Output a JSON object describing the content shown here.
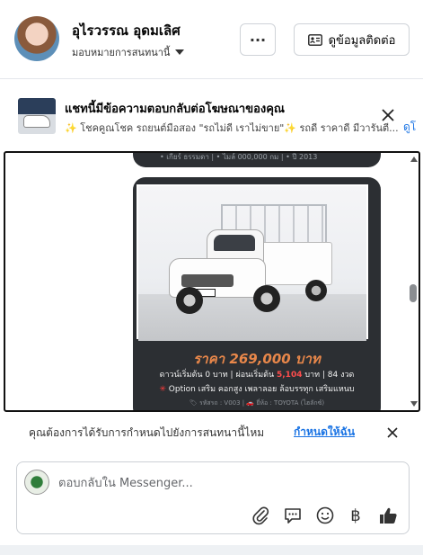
{
  "header": {
    "name": "อุไรวรรณ อุดมเลิศ",
    "role": "มอบหมายการสนทนานี้",
    "more_label": "···",
    "contact_label": "ดูข้อมูลติดต่อ"
  },
  "banner": {
    "title": "แชทนี้มีข้อความตอบกลับต่อโฆษณาของคุณ",
    "subtitle": "✨ โชคคูณโชค รถยนต์มือสอง \"รถไม่ดี เราไม่ขาย\"✨ รถดี ราคาดี มีวารันตี...",
    "link": "ดูโ"
  },
  "message": {
    "top_caption": "• เกียร์ ธรรมดา  |  • ไมล์ 000,000 กม  |  • ปี 2013",
    "price": "ราคา 269,000 บาท",
    "terms_prefix": "ดาวน์เริ่มต้น 0 บาท | ผ่อนเริ่มต้น ",
    "terms_amount": "5,104",
    "terms_suffix": " บาท | 84 งวด",
    "options_star": "✳",
    "options": " Option เสริม คอกสูง เพลาลอย ล้อบรรทุก เสริมแหนบ",
    "meta": "🏷 รหัสรถ : V003  |  🚗 ยี่ห้อ : TOYOTA (ไฮลักซ์)"
  },
  "assign": {
    "question": "คุณต้องการได้รับการกำหนดไปยังการสนทนานี้ไหม",
    "link": "กำหนดให้ฉัน"
  },
  "composer": {
    "placeholder": "ตอบกลับใน Messenger...",
    "currency_symbol": "฿"
  },
  "colors": {
    "link_blue": "#1b74e4",
    "bubble_dark": "#2c2f33",
    "price_orange": "#e8874a"
  }
}
